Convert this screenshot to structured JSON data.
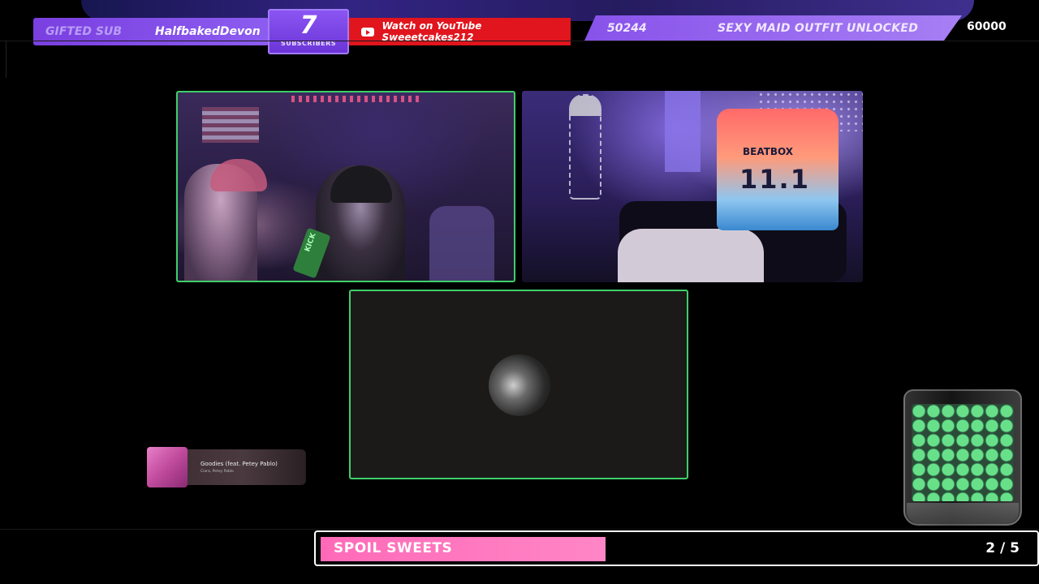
{
  "top_bar": {
    "gifted_label": "GIFTED SUB",
    "gifted_user": "HalfbakedDevon",
    "subscriber_count": "7",
    "subscriber_label": "SUBSCRIBERS",
    "youtube_text": "Watch on YouTube Sweeetcakes212",
    "goal_current": "50244",
    "goal_text": "SEXY MAID OUTFIT UNLOCKED",
    "goal_target": "60000"
  },
  "cams": {
    "cam1_mic_text": "KICK",
    "cam2_jersey_brand": "BEATBOX",
    "cam2_jersey_number": "11.1"
  },
  "now_playing": {
    "title": "Goodies (feat. Petey Pablo)",
    "artist": "Ciara, Petey Pablo"
  },
  "spoil_bar": {
    "label": "SPOIL SWEETS",
    "count": "2 / 5",
    "progress": 0.4
  },
  "colors": {
    "accent_purple": "#8752ea",
    "cam_border_green": "#3fcf6a",
    "youtube_red": "#e0151d",
    "spoil_pink": "#ff6ab8"
  }
}
